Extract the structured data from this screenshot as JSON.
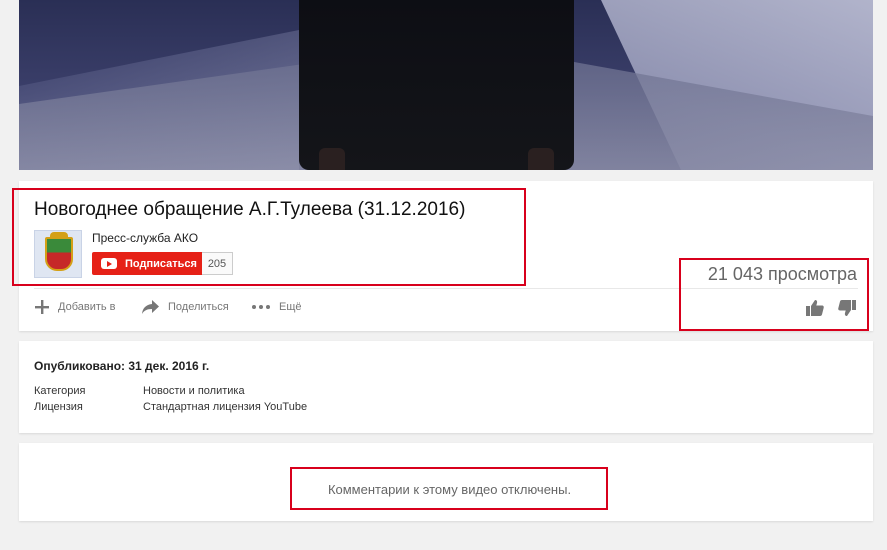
{
  "video": {
    "title": "Новогоднее обращение А.Г.Тулеева (31.12.2016)",
    "views": "21 043 просмотра"
  },
  "channel": {
    "name": "Пресс-служба АКО",
    "subscribe_label": "Подписаться",
    "subscriber_count": "205"
  },
  "actions": {
    "add_label": "Добавить в",
    "share_label": "Поделиться",
    "more_label": "Ещё"
  },
  "meta": {
    "published": "Опубликовано: 31 дек. 2016 г.",
    "rows": [
      {
        "label": "Категория",
        "value": "Новости и политика"
      },
      {
        "label": "Лицензия",
        "value": "Стандартная лицензия YouTube"
      }
    ]
  },
  "comments": {
    "disabled_text": "Комментарии к этому видео отключены."
  },
  "icons": {
    "add": "plus-icon",
    "share": "share-arrow-icon",
    "more": "more-dots-icon",
    "like": "thumb-up-icon",
    "dislike": "thumb-down-icon",
    "subscribe": "youtube-logo-icon"
  },
  "colors": {
    "subscribe_bg": "#e62117",
    "highlight": "#d8001c",
    "background": "#f1f1f1"
  }
}
